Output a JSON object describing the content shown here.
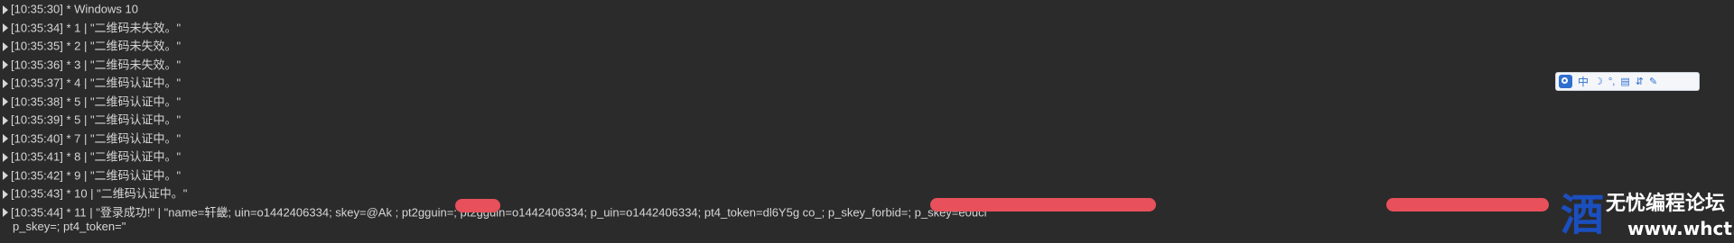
{
  "console": {
    "lines": [
      {
        "text": "[10:35:30] * Windows 10"
      },
      {
        "text": "[10:35:34] * 1 |  \"二维码未失效。\""
      },
      {
        "text": "[10:35:35] * 2 |  \"二维码未失效。\""
      },
      {
        "text": "[10:35:36] * 3 |  \"二维码未失效。\""
      },
      {
        "text": "[10:35:37] * 4 |  \"二维码认证中。\""
      },
      {
        "text": "[10:35:38] * 5 |  \"二维码认证中。\""
      },
      {
        "text": "[10:35:39] * 5 |  \"二维码认证中。\""
      },
      {
        "text": "[10:35:40] * 7 |  \"二维码认证中。\""
      },
      {
        "text": "[10:35:41] * 8 |  \"二维码认证中。\""
      },
      {
        "text": "[10:35:42] * 9 |  \"二维码认证中。\""
      },
      {
        "text": "[10:35:43] * 10 |  \"二维码认证中。\""
      },
      {
        "text": "[10:35:44] * 11 |  \"登录成功!\"  |  \"name=轩畿; uin=o1442406334; skey=@Ak           ; pt2gguin=; pt2gguin=o1442406334; p_uin=o1442406334; pt4_token=dl6Y5g                                                            co_; p_skey_forbid=; p_skey=e0ucl"
      }
    ],
    "continuation": "p_skey=; pt4_token=\""
  },
  "ime_toolbar": {
    "label_zh": "中",
    "symbols": [
      "☽",
      "°,",
      "▤",
      "⇵",
      "✎"
    ]
  },
  "watermark": {
    "icon": "酒",
    "title": "无忧编程论坛",
    "url": "www.whct.net"
  },
  "colors": {
    "background": "#2b2b2b",
    "text": "#d6d6d6",
    "redaction": "#e8505b",
    "ime_accent": "#2f6fd0"
  }
}
